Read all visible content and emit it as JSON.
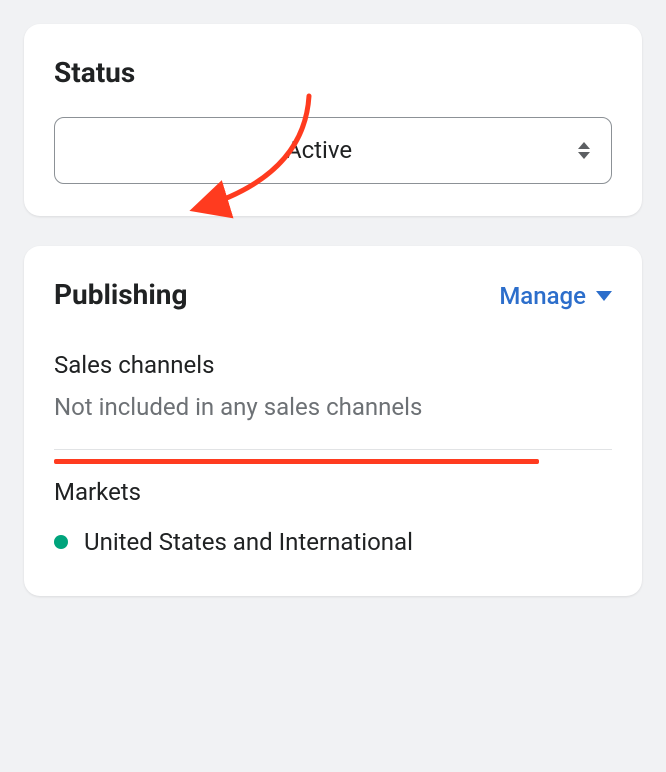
{
  "status": {
    "title": "Status",
    "value": "Active"
  },
  "publishing": {
    "title": "Publishing",
    "manage_label": "Manage",
    "sales_channels_label": "Sales channels",
    "sales_channels_text": "Not included in any sales channels",
    "markets_label": "Markets",
    "markets": [
      {
        "name": "United States and International",
        "status_color": "#00a47c"
      }
    ]
  },
  "colors": {
    "annotation": "#ff3b1f"
  }
}
